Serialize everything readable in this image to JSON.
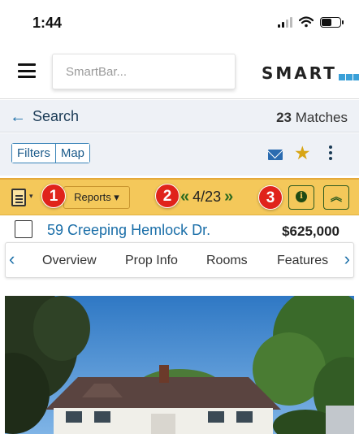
{
  "status_bar": {
    "time": "1:44",
    "signal_icon": "cellular-signal-icon",
    "wifi_icon": "wifi-icon",
    "battery_icon": "battery-icon"
  },
  "header": {
    "menu_icon": "hamburger-menu-icon",
    "smartbar_placeholder": "SmartBar...",
    "logo_text": "SMART",
    "logo_subtext": "MLS"
  },
  "search_bar": {
    "back_label": "Search",
    "match_count": "23",
    "match_label": "Matches"
  },
  "toolbar": {
    "filters_label": "Filters",
    "map_label": "Map",
    "email_icon": "envelope-icon",
    "favorite_icon": "star-icon",
    "more_icon": "kebab-menu-icon"
  },
  "listing_bar": {
    "reports_label": "Reports ▾",
    "pager_prev": "«",
    "pager_text": "4/23",
    "pager_next": "»",
    "info_icon": "info-icon",
    "collapse_icon": "double-chevron-up-icon",
    "collapse_glyph": "︽",
    "info_glyph": "i"
  },
  "badges": [
    "1",
    "2",
    "3"
  ],
  "listing": {
    "address": "59 Creeping Hemlock Dr.",
    "price": "$625,000"
  },
  "tabs": {
    "prev_glyph": "‹",
    "next_glyph": "›",
    "items": [
      "Overview",
      "Prop Info",
      "Rooms",
      "Features"
    ]
  },
  "colors": {
    "accent_blue": "#1a6ea8",
    "listing_bar_yellow": "#f4c85a",
    "badge_red": "#e0231b",
    "star_gold": "#d8a514"
  }
}
